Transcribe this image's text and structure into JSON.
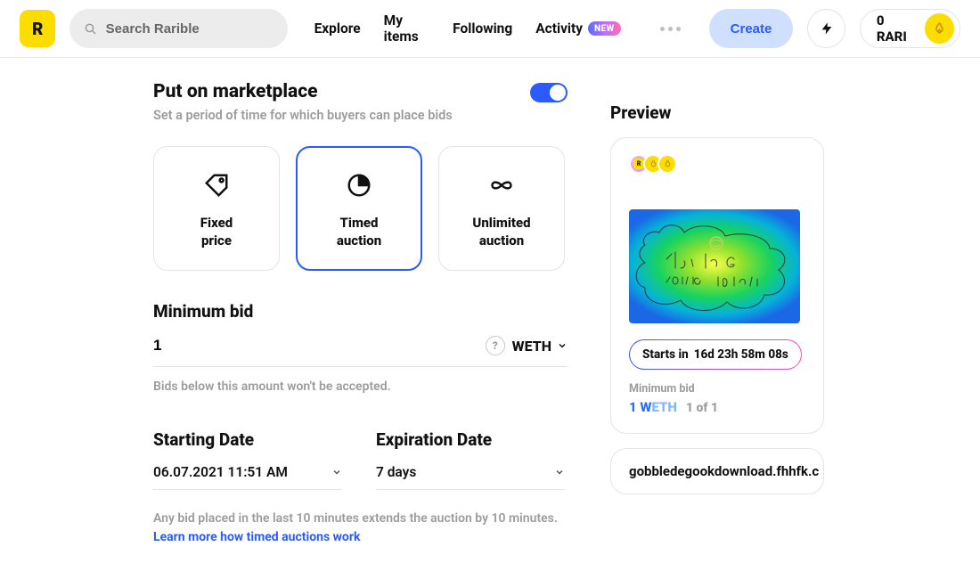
{
  "header": {
    "logo_text": "R",
    "search_placeholder": "Search Rarible",
    "nav": {
      "explore": "Explore",
      "my_items": "My items",
      "following": "Following",
      "activity": "Activity",
      "activity_badge": "NEW"
    },
    "create": "Create",
    "balance": "0 RARI"
  },
  "main": {
    "marketplace_title": "Put on marketplace",
    "marketplace_sub": "Set a period of time for which buyers can place bids",
    "options": {
      "fixed": "Fixed\nprice",
      "timed": "Timed\nauction",
      "unlimited": "Unlimited\nauction"
    },
    "min_bid_title": "Minimum bid",
    "min_bid_value": "1",
    "currency": "WETH",
    "min_bid_hint": "Bids below this amount won't be accepted.",
    "start_label": "Starting Date",
    "start_value": "06.07.2021 11:51 AM",
    "exp_label": "Expiration Date",
    "exp_value": "7 days",
    "extend_note": "Any bid placed in the last 10 minutes extends the auction by 10 minutes.",
    "learn_more": "Learn more how timed auctions work"
  },
  "preview": {
    "title": "Preview",
    "countdown_label": "Starts in",
    "countdown_value": "16d  23h 58m 08s",
    "min_bid_label": "Minimum bid",
    "min_bid_amount": "1 W",
    "min_bid_suffix": "ETH",
    "edition": "1 of 1",
    "link_text": "gobbledegookdownload.fhhfk.c"
  }
}
